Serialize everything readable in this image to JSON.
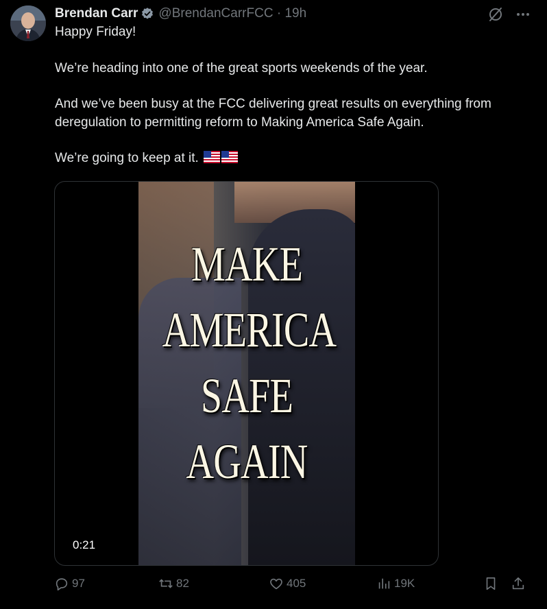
{
  "author": {
    "name": "Brendan Carr",
    "handle": "@BrendanCarrFCC",
    "separator": "·",
    "time": "19h",
    "verified_color": "#8b98a5"
  },
  "post": {
    "paragraphs": [
      "Happy Friday!",
      "We’re heading into one of the great sports weekends of the year.",
      "And we’ve been busy at the FCC delivering great results on everything from deregulation to permitting reform to Making America Safe Again.",
      "We’re going to keep at it."
    ],
    "emoji": [
      "us-flag",
      "us-flag"
    ]
  },
  "media": {
    "overlay_lines": [
      "MAKE",
      "AMERICA",
      "SAFE",
      "AGAIN"
    ],
    "duration": "0:21"
  },
  "actions": {
    "replies": "97",
    "reposts": "82",
    "likes": "405",
    "views": "19K"
  },
  "colors": {
    "background": "#000000",
    "text": "#e7e9ea",
    "muted": "#71767b",
    "border": "#2f3336"
  }
}
